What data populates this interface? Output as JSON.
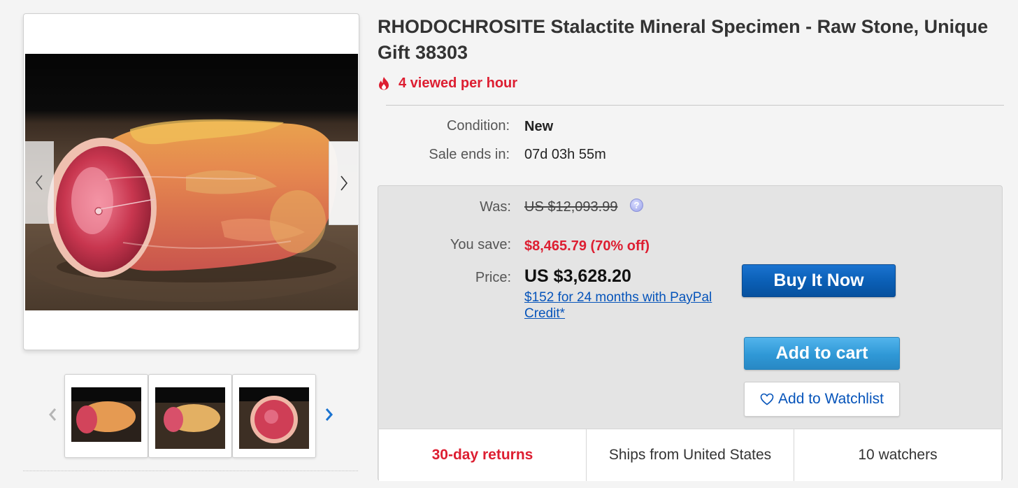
{
  "listing": {
    "title": "RHODOCHROSITE Stalactite Mineral Specimen - Raw Stone, Unique Gift 38303",
    "viewed": "4 viewed per hour"
  },
  "details": {
    "condition_label": "Condition:",
    "condition_value": "New",
    "sale_ends_label": "Sale ends in:",
    "sale_ends_value": "07d 03h 55m"
  },
  "pricing": {
    "was_label": "Was:",
    "was_value": "US $12,093.99",
    "help_glyph": "?",
    "save_label": "You save:",
    "save_value": "$8,465.79 (70% off)",
    "price_label": "Price:",
    "price_value": "US $3,628.20",
    "credit_text": "$152 for 24 months with PayPal Credit*"
  },
  "actions": {
    "buy_now": "Buy It Now",
    "add_to_cart": "Add to cart",
    "watchlist": "Add to Watchlist"
  },
  "highlights": [
    "30-day returns",
    "Ships from United States",
    "10 watchers"
  ],
  "colors": {
    "alert_red": "#dd1e31",
    "link_blue": "#0654ba",
    "buy_blue": "#0a5eb4",
    "cart_blue": "#2f98d6",
    "nav_blue": "#1a73d0"
  },
  "icons": {
    "viewed": "flame-icon",
    "gallery_prev": "chevron-left-icon",
    "gallery_next": "chevron-right-icon",
    "thumb_prev": "chevron-left-icon",
    "thumb_next": "chevron-right-icon",
    "watchlist": "heart-icon",
    "help": "help-icon"
  }
}
